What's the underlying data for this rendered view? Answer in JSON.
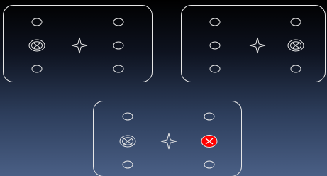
{
  "colors": {
    "stroke": "#e6e6e6",
    "highlight_fill": "#ff0000",
    "highlight_mark": "#ffffff",
    "background_top": "#000000",
    "background_bottom": "#4a5f85"
  },
  "panels": [
    {
      "name": "panel-top-left",
      "center_icon": "four-point-star-icon",
      "slots": [
        {
          "position": "left-top",
          "state": "empty"
        },
        {
          "position": "left-middle",
          "state": "crossed"
        },
        {
          "position": "left-bottom",
          "state": "empty"
        },
        {
          "position": "right-top",
          "state": "empty"
        },
        {
          "position": "right-middle",
          "state": "empty"
        },
        {
          "position": "right-bottom",
          "state": "empty"
        }
      ]
    },
    {
      "name": "panel-top-right",
      "center_icon": "four-point-star-icon",
      "slots": [
        {
          "position": "left-top",
          "state": "empty"
        },
        {
          "position": "left-middle",
          "state": "empty"
        },
        {
          "position": "left-bottom",
          "state": "empty"
        },
        {
          "position": "right-top",
          "state": "empty"
        },
        {
          "position": "right-middle",
          "state": "crossed"
        },
        {
          "position": "right-bottom",
          "state": "empty"
        }
      ]
    },
    {
      "name": "panel-bottom-center",
      "center_icon": "four-point-star-icon",
      "slots": [
        {
          "position": "left-top",
          "state": "empty"
        },
        {
          "position": "left-middle",
          "state": "crossed"
        },
        {
          "position": "left-bottom",
          "state": "empty"
        },
        {
          "position": "right-top",
          "state": "empty"
        },
        {
          "position": "right-middle",
          "state": "highlighted"
        },
        {
          "position": "right-bottom",
          "state": "empty"
        }
      ]
    }
  ]
}
